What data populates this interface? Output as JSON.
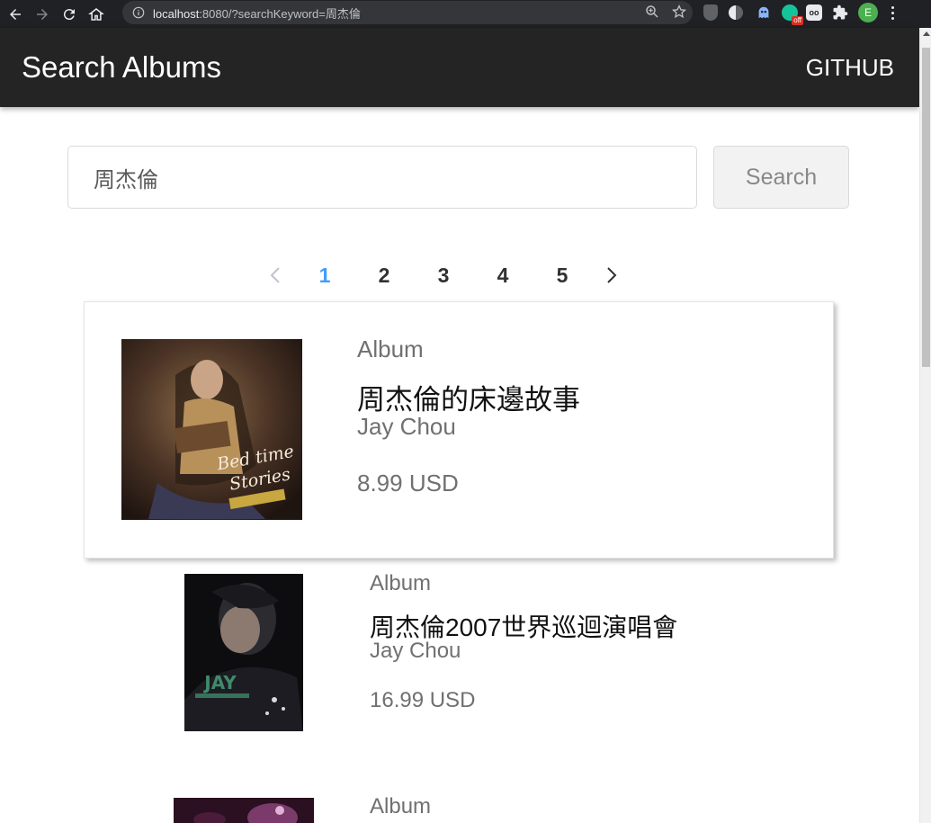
{
  "browser": {
    "url_host": "localhost",
    "url_rest": ":8080/?searchKeyword=周杰倫",
    "extension_off_badge": "off",
    "profile_initial": "E"
  },
  "header": {
    "title": "Search Albums",
    "github_link": "GITHUB"
  },
  "search": {
    "value": "周杰倫",
    "button_label": "Search"
  },
  "pagination": {
    "pages": [
      "1",
      "2",
      "3",
      "4",
      "5"
    ],
    "current": "1"
  },
  "albums": [
    {
      "type": "Album",
      "title": "周杰倫的床邊故事",
      "artist": "Jay Chou",
      "price": "8.99 USD",
      "cover_text": "Bedtime Stories"
    },
    {
      "type": "Album",
      "title": "周杰倫2007世界巡迴演唱會",
      "artist": "Jay Chou",
      "price": "16.99 USD",
      "cover_text": "JAY"
    },
    {
      "type": "Album"
    }
  ],
  "colors": {
    "header_bg": "#242424",
    "active_page": "#409eff"
  }
}
